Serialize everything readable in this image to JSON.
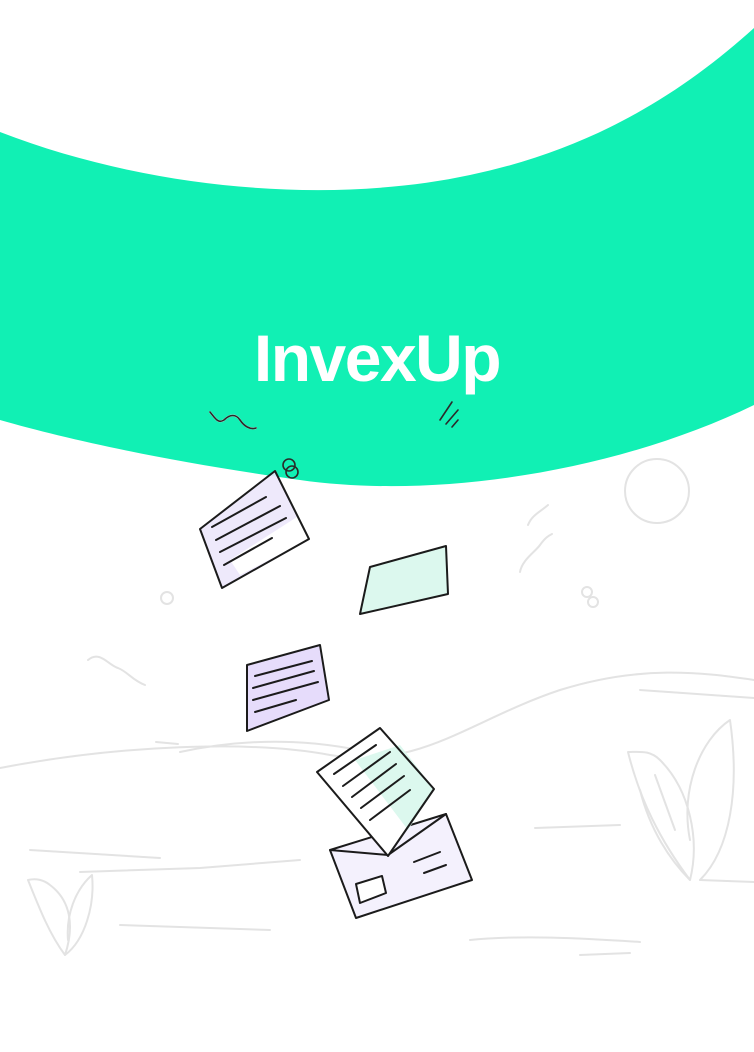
{
  "brand": {
    "name": "InvexUp"
  },
  "colors": {
    "banner": "#11f0b4",
    "background": "#ffffff",
    "line_art": "#e3e3e3",
    "ink": "#1b1b1b",
    "lavender": "#ece7fb",
    "mint": "#dcf8ee"
  },
  "illustration": {
    "subject": "flying-documents-and-envelope"
  }
}
